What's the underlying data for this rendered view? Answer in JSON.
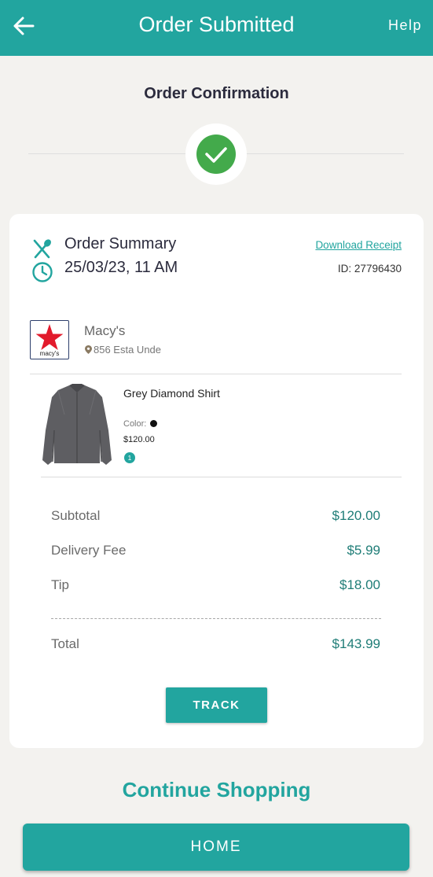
{
  "header": {
    "title": "Order Submitted",
    "help_label": "Help"
  },
  "confirmation": {
    "title": "Order Confirmation"
  },
  "summary": {
    "title": "Order Summary",
    "datetime": "25/03/23, 11 AM",
    "download_label": "Download Receipt",
    "order_id": "ID: 27796430"
  },
  "store": {
    "name": "Macy's",
    "address": "856 Esta Unde",
    "logo_text": "macy's"
  },
  "product": {
    "name": "Grey Diamond Shirt",
    "color_label": "Color:",
    "color_value": "#111111",
    "price": "$120.00",
    "quantity": "1"
  },
  "totals": {
    "subtotal_label": "Subtotal",
    "subtotal_value": "$120.00",
    "delivery_label": "Delivery Fee",
    "delivery_value": "$5.99",
    "tip_label": "Tip",
    "tip_value": "$18.00",
    "total_label": "Total",
    "total_value": "$143.99"
  },
  "actions": {
    "track_label": "TRACK",
    "continue_label": "Continue Shopping",
    "home_label": "HOME"
  },
  "colors": {
    "accent": "#22a59f",
    "success": "#43aa4b",
    "background": "#f3f2ef"
  },
  "icons": {
    "back": "arrow-left-icon",
    "check": "check-icon",
    "fork_spoon": "fork-spoon-icon",
    "clock": "clock-icon",
    "pin": "location-pin-icon",
    "logo_star": "star-icon"
  }
}
